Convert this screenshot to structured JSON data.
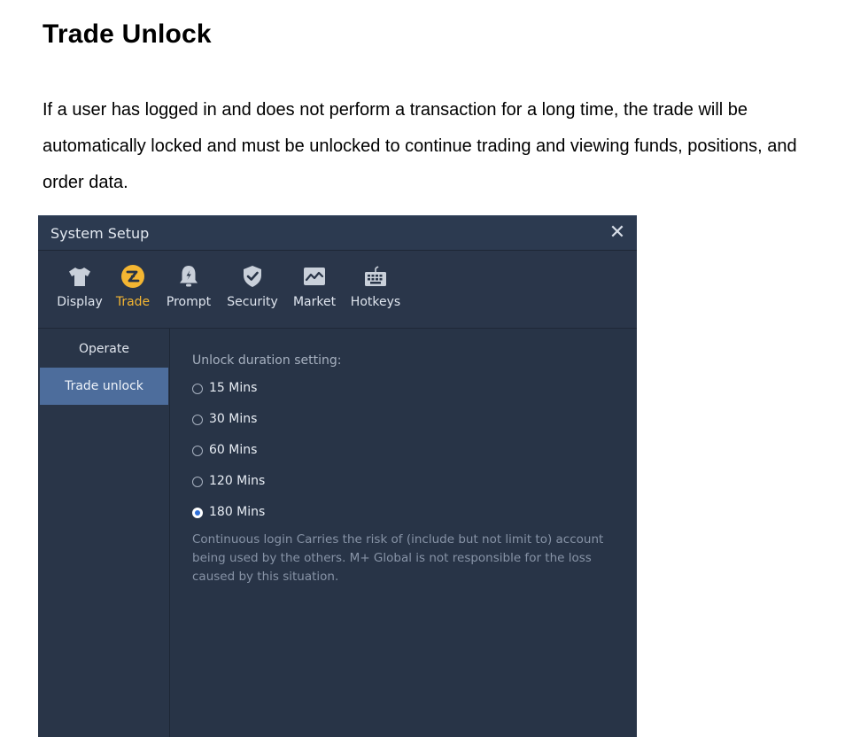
{
  "doc": {
    "title": "Trade Unlock",
    "paragraph": "If a user has logged in and does not perform a transaction for a long time, the trade will be automatically locked and must be unlocked to continue trading and viewing funds, positions, and order data."
  },
  "window": {
    "title": "System Setup",
    "close_glyph": "✕"
  },
  "toolbar": {
    "items": [
      {
        "label": "Display",
        "icon": "shirt-icon"
      },
      {
        "label": "Trade",
        "icon": "trade-icon",
        "active": true
      },
      {
        "label": "Prompt",
        "icon": "bell-icon"
      },
      {
        "label": "Security",
        "icon": "shield-icon"
      },
      {
        "label": "Market",
        "icon": "chart-icon"
      },
      {
        "label": "Hotkeys",
        "icon": "keyboard-icon"
      }
    ]
  },
  "sidebar": {
    "items": [
      {
        "label": "Operate"
      },
      {
        "label": "Trade unlock",
        "active": true
      }
    ]
  },
  "content": {
    "setting_label": "Unlock duration setting:",
    "options": [
      {
        "label": "15 Mins",
        "checked": false
      },
      {
        "label": "30 Mins",
        "checked": false
      },
      {
        "label": "60 Mins",
        "checked": false
      },
      {
        "label": "120 Mins",
        "checked": false
      },
      {
        "label": "180 Mins",
        "checked": true
      }
    ],
    "notice": "Continuous login Carries the risk of (include but not limit to) account being used by the others. M+ Global is not responsible for the loss caused by this situation."
  },
  "colors": {
    "accent": "#f4b632",
    "window_bg": "#283447",
    "sidebar_active": "#4d6d9c",
    "radio_checked": "#2f6fd8"
  }
}
